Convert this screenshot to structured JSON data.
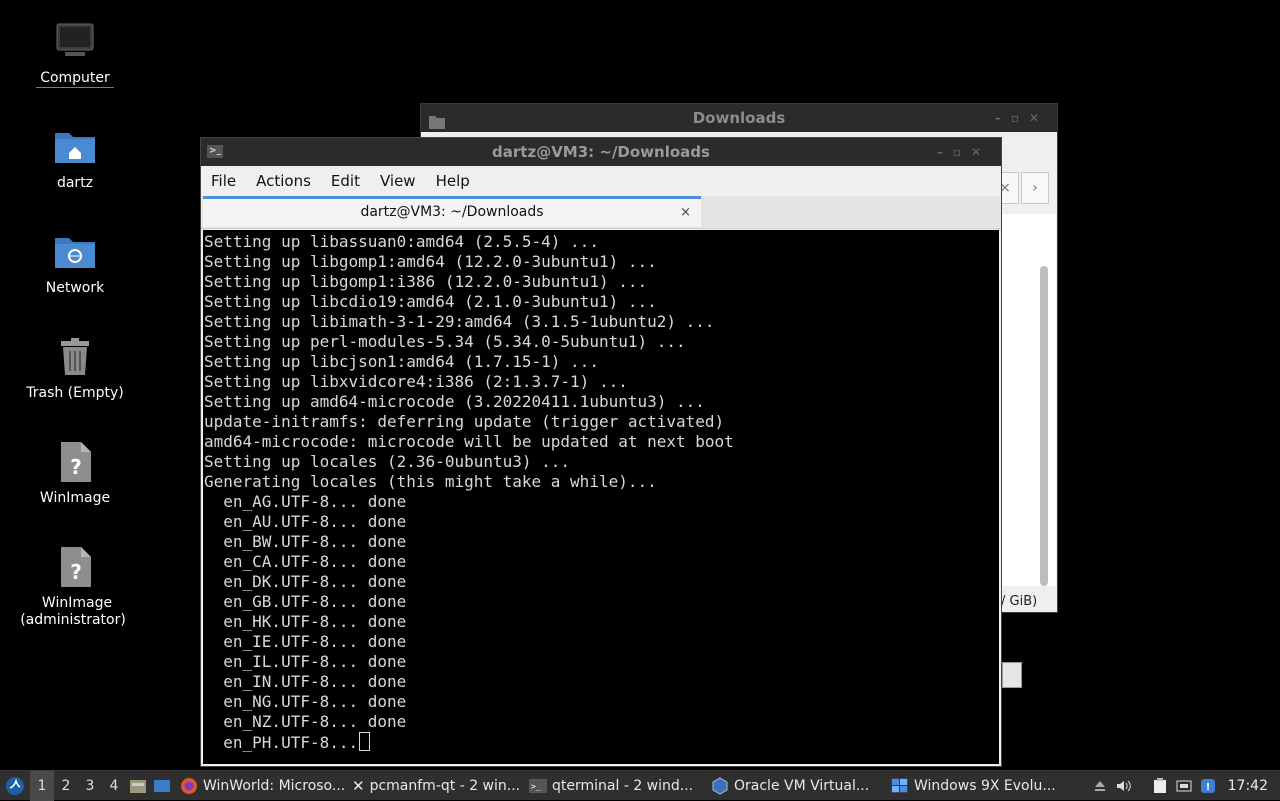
{
  "desktop": {
    "icons": [
      {
        "label": "Computer",
        "icon": "computer-icon"
      },
      {
        "label": "dartz",
        "icon": "home-folder-icon"
      },
      {
        "label": "Network",
        "icon": "network-folder-icon"
      },
      {
        "label": "Trash (Empty)",
        "icon": "trash-icon"
      },
      {
        "label": "WinImage",
        "icon": "unknown-file-icon"
      },
      {
        "label": "WinImage (administrator)",
        "icon": "unknown-file-icon"
      }
    ]
  },
  "downloads_window": {
    "title": "Downloads",
    "status_partial": "/ GiB)",
    "nav_prev": "×",
    "nav_next": "›"
  },
  "terminal_window": {
    "title": "dartz@VM3: ~/Downloads",
    "menu": [
      "File",
      "Actions",
      "Edit",
      "View",
      "Help"
    ],
    "tab_label": "dartz@VM3: ~/Downloads",
    "tab_close": "×",
    "lines": [
      "Setting up libassuan0:amd64 (2.5.5-4) ...",
      "Setting up libgomp1:amd64 (12.2.0-3ubuntu1) ...",
      "Setting up libgomp1:i386 (12.2.0-3ubuntu1) ...",
      "Setting up libcdio19:amd64 (2.1.0-3ubuntu1) ...",
      "Setting up libimath-3-1-29:amd64 (3.1.5-1ubuntu2) ...",
      "Setting up perl-modules-5.34 (5.34.0-5ubuntu1) ...",
      "Setting up libcjson1:amd64 (1.7.15-1) ...",
      "Setting up libxvidcore4:i386 (2:1.3.7-1) ...",
      "Setting up amd64-microcode (3.20220411.1ubuntu3) ...",
      "update-initramfs: deferring update (trigger activated)",
      "amd64-microcode: microcode will be updated at next boot",
      "Setting up locales (2.36-0ubuntu3) ...",
      "Generating locales (this might take a while)...",
      "  en_AG.UTF-8... done",
      "  en_AU.UTF-8... done",
      "  en_BW.UTF-8... done",
      "  en_CA.UTF-8... done",
      "  en_DK.UTF-8... done",
      "  en_GB.UTF-8... done",
      "  en_HK.UTF-8... done",
      "  en_IE.UTF-8... done",
      "  en_IL.UTF-8... done",
      "  en_IN.UTF-8... done",
      "  en_NG.UTF-8... done",
      "  en_NZ.UTF-8... done"
    ],
    "prompt_line": "  en_PH.UTF-8..."
  },
  "taskbar": {
    "desktops": [
      "1",
      "2",
      "3",
      "4"
    ],
    "active_desktop": "1",
    "tasks": [
      {
        "label": "WinWorld: Microso...",
        "icon": "firefox-icon"
      },
      {
        "label": "pcmanfm-qt - 2 win...",
        "icon": "close-x-icon"
      },
      {
        "label": "qterminal - 2 wind...",
        "icon": "terminal-icon"
      },
      {
        "label": "Oracle VM Virtual...",
        "icon": "virtualbox-icon"
      },
      {
        "label": "Windows 9X Evolu...",
        "icon": "windows-app-icon"
      }
    ],
    "clock": "17:42",
    "colors": {
      "accent": "#4a90d9",
      "folder": "#4a86c8"
    }
  }
}
